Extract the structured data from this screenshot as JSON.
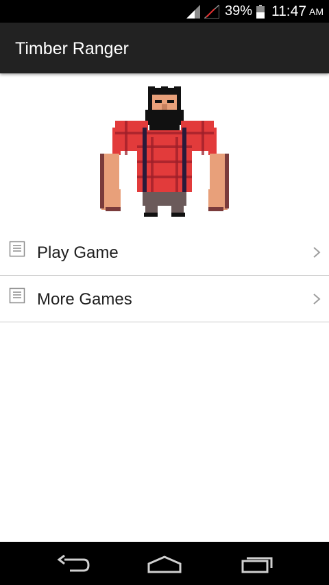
{
  "status_bar": {
    "battery_text": "39%",
    "time": "11:47",
    "ampm": "AM",
    "icons": [
      "signal-icon",
      "no-sim-icon",
      "battery-icon"
    ]
  },
  "app_bar": {
    "title": "Timber Ranger"
  },
  "hero": {
    "icon": "lumberjack-pixel-art"
  },
  "menu": {
    "items": [
      {
        "label": "Play Game",
        "icon": "document-icon",
        "trailing_icon": "chevron-right-icon"
      },
      {
        "label": "More Games",
        "icon": "document-icon",
        "trailing_icon": "chevron-right-icon"
      }
    ]
  },
  "nav_bar": {
    "buttons": [
      "back-icon",
      "home-icon",
      "recents-icon"
    ]
  },
  "colors": {
    "status_bar": "#000000",
    "action_bar": "#222222",
    "background": "#ffffff",
    "divider": "#c8c8c8",
    "shirt_red": "#e23b3b",
    "skin": "#e8a07a"
  }
}
